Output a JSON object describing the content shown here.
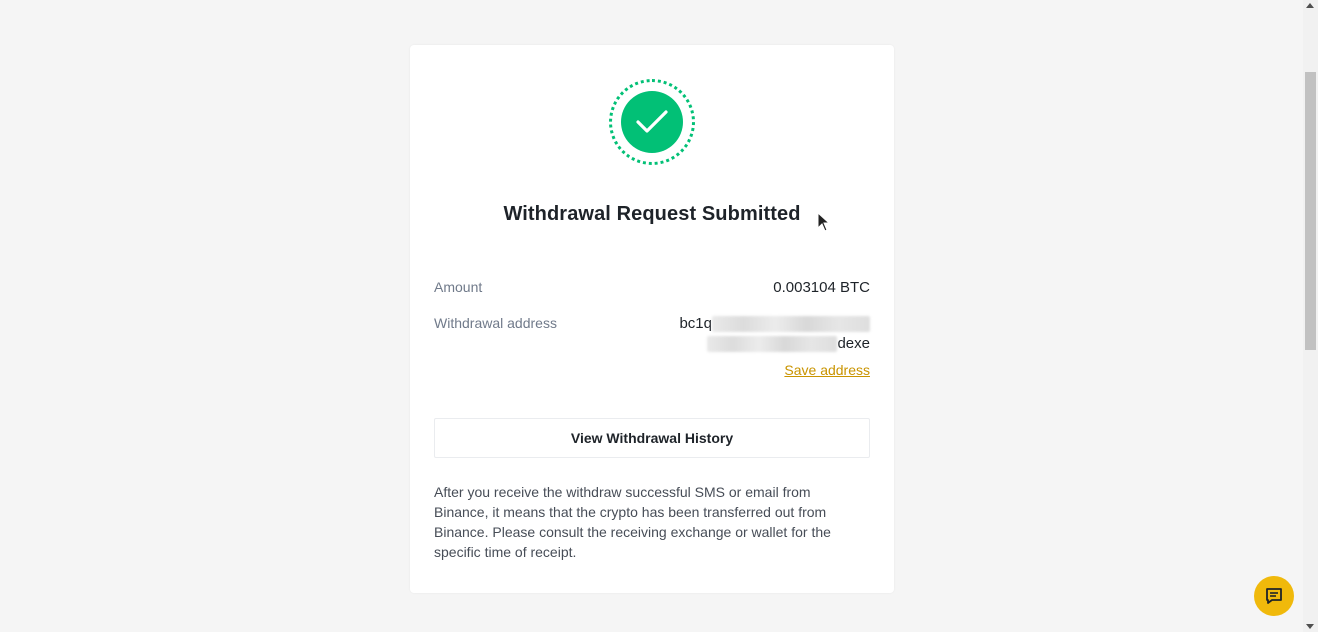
{
  "status": {
    "title": "Withdrawal Request Submitted",
    "icon": "checkmark-icon",
    "accent_color": "#02c076"
  },
  "details": {
    "amount_label": "Amount",
    "amount_value": "0.003104 BTC",
    "address_label": "Withdrawal address",
    "address_prefix": "bc1q",
    "address_suffix": "dexe",
    "save_address": "Save address"
  },
  "actions": {
    "view_history": "View Withdrawal History"
  },
  "note": "After you receive the withdraw successful SMS or email from Binance, it means that the crypto has been transferred out from Binance. Please consult the receiving exchange or wallet for the specific time of receipt.",
  "chat": {
    "icon": "chat-icon",
    "color": "#f0b90b"
  },
  "link_color": "#c99400"
}
